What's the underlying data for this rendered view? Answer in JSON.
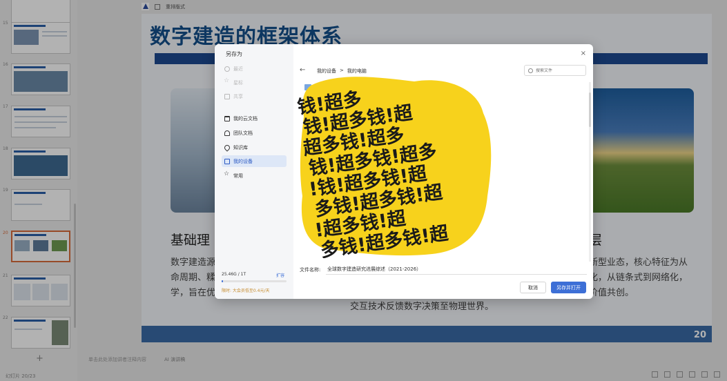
{
  "app": {
    "toolbar_label": "重排版式",
    "notes_hint": "单击此处添加讲者注释内容",
    "ai_notes_label": "AI 演讲稿",
    "status_left": "幻灯片 20/23",
    "add_slide_label": "+"
  },
  "thumbnails": [
    {
      "num": "15"
    },
    {
      "num": "16"
    },
    {
      "num": "17"
    },
    {
      "num": "18"
    },
    {
      "num": "19"
    },
    {
      "num": "20",
      "active": true
    },
    {
      "num": "21"
    },
    {
      "num": "22"
    }
  ],
  "slide": {
    "title": "数字建造的框架体系",
    "heading_left": "基础理",
    "heading_right": "层",
    "body_left": [
      "数字建造源",
      "命周期、糅",
      "学，旨在优"
    ],
    "body_right": [
      "新型业态，核心特征为从",
      "化，从链条式到网络化，",
      "价值共创。"
    ],
    "body_bottom": "交互技术反馈数字决策至物理世界。",
    "number": "20"
  },
  "dialog": {
    "title": "另存为",
    "close_label": "×",
    "back_label": "←",
    "nav": [
      {
        "label": "最近",
        "icon": "clock-icon",
        "disabled": true
      },
      {
        "label": "星标",
        "icon": "star-icon",
        "disabled": true
      },
      {
        "label": "共享",
        "icon": "share-icon",
        "disabled": true
      },
      {
        "label": "我的云文档",
        "icon": "folder-icon"
      },
      {
        "label": "团队文档",
        "icon": "team-icon"
      },
      {
        "label": "知识库",
        "icon": "pin-icon"
      },
      {
        "label": "我的设备",
        "icon": "device-icon",
        "selected": true
      },
      {
        "label": "常用",
        "icon": "favorite-icon"
      }
    ],
    "breadcrumb": [
      "我的设备",
      ">",
      "我的电脑"
    ],
    "search_placeholder": "搜索文件",
    "sticker_text": [
      "钱!超多",
      "钱!超多钱!超",
      "超多钱!超多",
      "钱!超多钱!超多",
      "!钱!超多钱!超",
      "多钱!超多钱!超",
      "!超多钱!超",
      "多钱!超多钱!超"
    ],
    "filename_label": "文件名称:",
    "filename_value": "全球数字建造研究进展综述（2021-2026）",
    "storage_text": "25.46G / 1T",
    "storage_ratio": 0.025,
    "expand_label": "扩容",
    "promo_text": "限时: 大会员低至0.4元/天",
    "cancel_label": "取消",
    "save_open_label": "另存并打开"
  },
  "colors": {
    "accent": "#3d6fd6",
    "slide_title": "#14508c",
    "sticker_yellow": "#f7d21c"
  }
}
